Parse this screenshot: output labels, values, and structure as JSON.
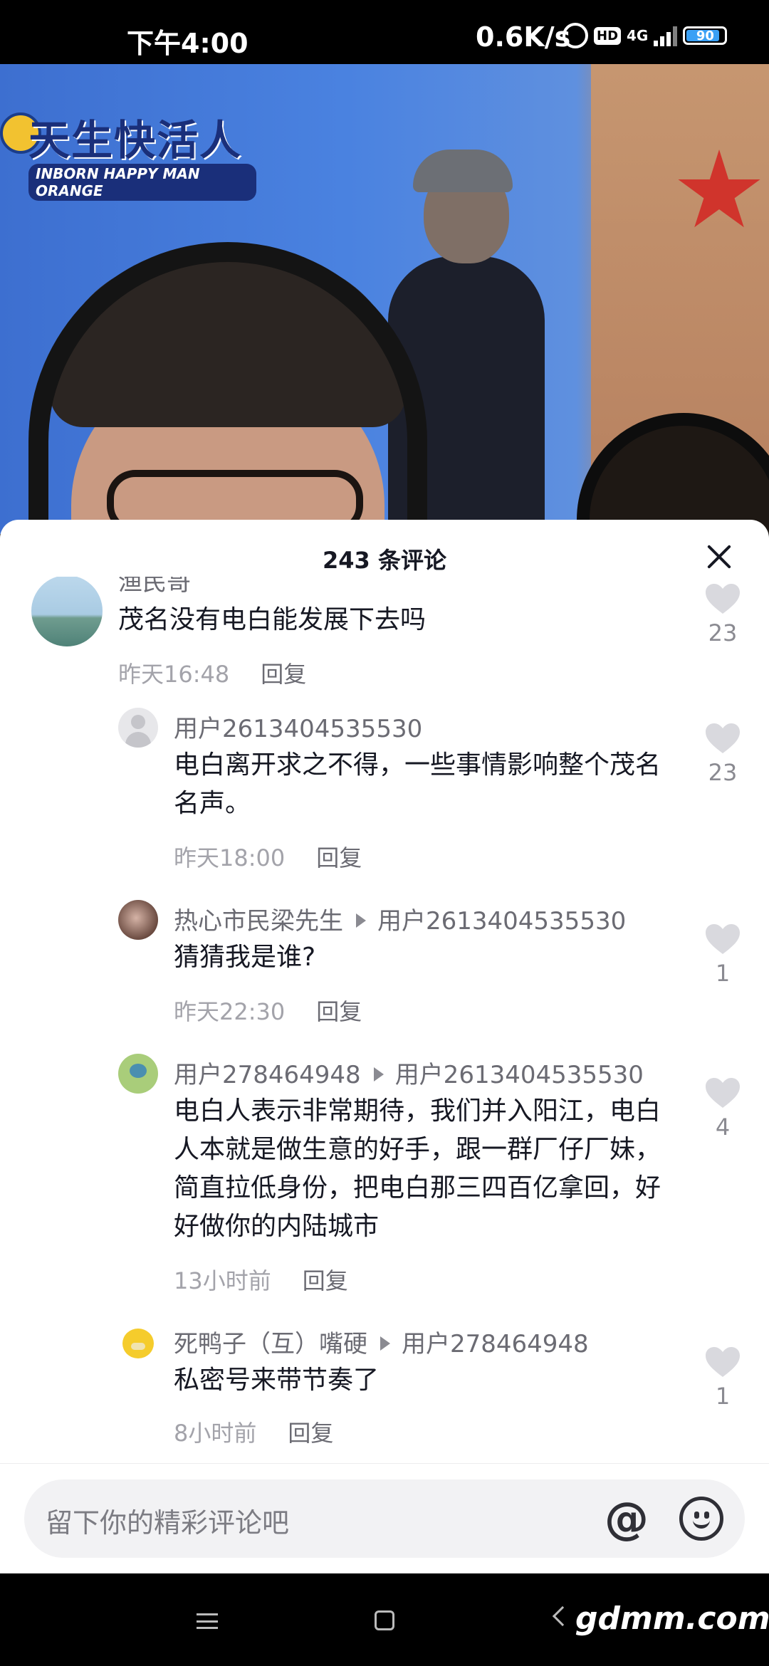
{
  "status_bar": {
    "time": "下午4:00",
    "net_speed": "0.6K/s",
    "hd_label": "HD",
    "network": "4G",
    "battery_level": "90"
  },
  "video": {
    "banner_title": "天生快活人",
    "banner_subtitle": "INBORN HAPPY MAN ORANGE"
  },
  "sheet": {
    "title": "243 条评论"
  },
  "comments": [
    {
      "name": "渔民哥",
      "text": "茂名没有电白能发展下去吗",
      "time": "昨天16:48",
      "reply_label": "回复",
      "likes": "23"
    },
    {
      "name": "用户2613404535530",
      "text": "电白离开求之不得，一些事情影响整个茂名名声。",
      "time": "昨天18:00",
      "reply_label": "回复",
      "likes": "23"
    },
    {
      "name": "热心市民梁先生",
      "reply_to": "用户2613404535530",
      "text": "猜猜我是谁?",
      "time": "昨天22:30",
      "reply_label": "回复",
      "likes": "1"
    },
    {
      "name": "用户278464948",
      "reply_to": "用户2613404535530",
      "text": "电白人表示非常期待，我们并入阳江，电白人本就是做生意的好手，跟一群厂仔厂妹，简直拉低身份，把电白那三四百亿拿回，好好做你的内陆城市",
      "time": "13小时前",
      "reply_label": "回复",
      "likes": "4"
    },
    {
      "name": "死鸭子（互）嘴硬",
      "reply_to": "用户278464948",
      "text": "私密号来带节奏了",
      "time": "8小时前",
      "reply_label": "回复",
      "likes": "1"
    }
  ],
  "input": {
    "placeholder": "留下你的精彩评论吧",
    "at_symbol": "@"
  },
  "watermark": "gdmm.com",
  "icons": {
    "like": "heart-icon",
    "close": "close-icon",
    "emoji": "smiley-icon",
    "mention": "at-icon"
  },
  "colors": {
    "like_icon": "#d9d9de",
    "text_primary": "#161823",
    "text_secondary": "#6b6b73",
    "text_meta": "#a3a3aa"
  }
}
